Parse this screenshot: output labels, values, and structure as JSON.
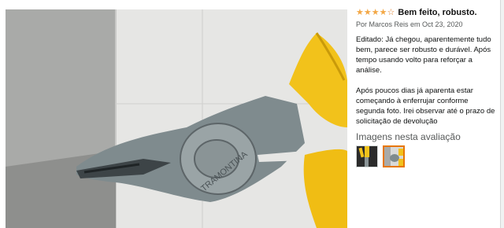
{
  "review": {
    "rating": 4,
    "max_rating": 5,
    "title": "Bem feito, robusto.",
    "byline": "Por Marcos Reis em Oct 23, 2020",
    "body": "Editado: Já chegou, aparentemente tudo bem, parece ser robusto e durável. Após tempo usando volto para reforçar a análise.\n\nApós poucos dias já aparenta estar começando à enferrujar conforme segunda foto. Irei observar até o prazo de solicitação de devolução"
  },
  "images_section": {
    "heading": "Imagens nesta avaliação",
    "selected_index": 1,
    "thumbnails": [
      {
        "icon": "pliers-photo-1"
      },
      {
        "icon": "pliers-photo-2"
      }
    ]
  },
  "photo": {
    "icon": "pliers-closeup-photo",
    "engraving": "TRAMONTINA"
  },
  "colors": {
    "star": "#f3a847",
    "selected_border": "#e77600",
    "handle_yellow": "#f2c21b"
  }
}
